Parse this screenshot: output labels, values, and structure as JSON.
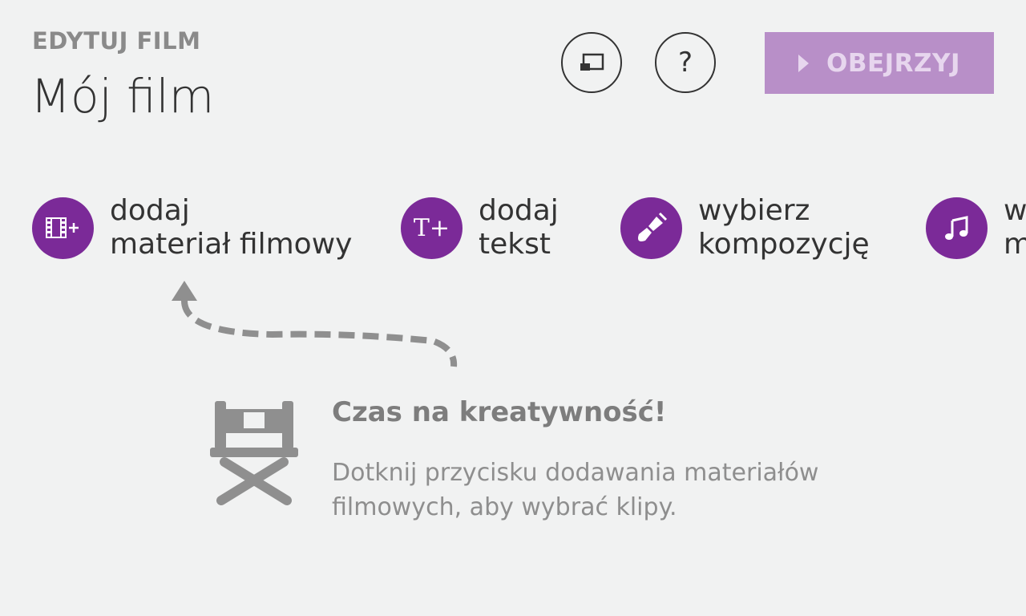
{
  "header": {
    "section_label": "EDYTUJ FILM",
    "title": "Mój film"
  },
  "toolbar": {
    "cast_icon": "cast-icon",
    "help_label": "?",
    "play_label": "OBEJRZYJ",
    "play_color": "#b88fc8"
  },
  "actions": [
    {
      "icon": "add-video-icon",
      "line1": "dodaj",
      "line2": "materiał filmowy"
    },
    {
      "icon": "add-text-icon",
      "glyph": "T+",
      "line1": "dodaj",
      "line2": "tekst"
    },
    {
      "icon": "brush-icon",
      "line1": "wybierz",
      "line2": "kompozycję"
    },
    {
      "icon": "music-icon",
      "line1": "wybierz",
      "line2": "muzykę"
    }
  ],
  "empty_state": {
    "icon": "director-chair-icon",
    "title": "Czas na kreatywność!",
    "description": "Dotknij przycisku dodawania materiałów filmowych, aby wybrać klipy."
  },
  "colors": {
    "accent": "#7b2a98",
    "background": "#f1f2f2",
    "text": "#333333",
    "muted": "#8a8a8a"
  }
}
